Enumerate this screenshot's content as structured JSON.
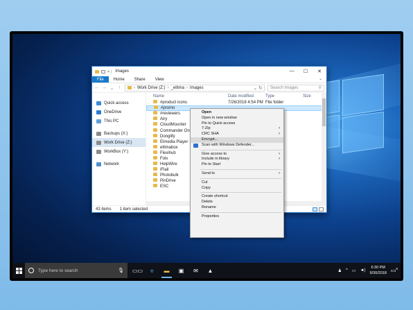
{
  "explorer": {
    "title": "Images",
    "tabs": [
      "File",
      "Home",
      "Share",
      "View"
    ],
    "breadcrumb": [
      "Work Drive (Z:)",
      "_eltima",
      "Images"
    ],
    "search_placeholder": "Search Images",
    "columns": [
      "Name",
      "Date modified",
      "Type",
      "Size"
    ],
    "nav_items": [
      {
        "label": "Quick access",
        "icon": "star-icon",
        "color": "#3b8ad9"
      },
      {
        "label": "OneDrive",
        "icon": "cloud-icon",
        "color": "#2b7cd3"
      },
      {
        "label": "This PC",
        "icon": "computer-icon",
        "color": "#5fa0dd"
      },
      {
        "label": "Backups (X:)",
        "icon": "drive-icon",
        "color": "#8a8a8a"
      },
      {
        "label": "Work Drive (Z:)",
        "icon": "drive-icon",
        "color": "#8a8a8a",
        "selected": true
      },
      {
        "label": "WorkBox (Y:)",
        "icon": "drive-icon",
        "color": "#8a8a8a"
      },
      {
        "label": "Network",
        "icon": "network-icon",
        "color": "#4f8fd0"
      }
    ],
    "files": [
      {
        "name": "#product icons",
        "date": "7/26/2018 4:54 PM",
        "type": "File folder"
      },
      {
        "name": "#promo",
        "date": "",
        "type": "",
        "selected": true
      },
      {
        "name": "#reviewers",
        "date": "",
        "type": ""
      },
      {
        "name": "Airy",
        "date": "",
        "type": ""
      },
      {
        "name": "CloudMounter",
        "date": "",
        "type": ""
      },
      {
        "name": "Commander One",
        "date": "",
        "type": ""
      },
      {
        "name": "Donglify",
        "date": "",
        "type": ""
      },
      {
        "name": "Elmedia Player",
        "date": "",
        "type": ""
      },
      {
        "name": "eltimabox",
        "date": "",
        "type": ""
      },
      {
        "name": "Flexihub",
        "date": "",
        "type": ""
      },
      {
        "name": "Folx",
        "date": "",
        "type": ""
      },
      {
        "name": "HelpWire",
        "date": "",
        "type": ""
      },
      {
        "name": "iFlail",
        "date": "",
        "type": ""
      },
      {
        "name": "Photobulk",
        "date": "",
        "type": ""
      },
      {
        "name": "PinDrive",
        "date": "",
        "type": ""
      },
      {
        "name": "ESC",
        "date": "",
        "type": ""
      }
    ],
    "status_count": "43 items",
    "status_selected": "1 item selected"
  },
  "context_menu": {
    "items": [
      {
        "label": "Open",
        "bold": true
      },
      {
        "label": "Open in new window"
      },
      {
        "label": "Pin to Quick access"
      },
      {
        "label": "7-Zip",
        "submenu": true
      },
      {
        "label": "CRC SHA",
        "submenu": true
      },
      {
        "label": "Encrypt...",
        "highlighted": true
      },
      {
        "label": "Scan with Windows Defender...",
        "shield": true
      },
      {
        "sep": true
      },
      {
        "label": "Give access to",
        "submenu": true
      },
      {
        "label": "Include in library",
        "submenu": true
      },
      {
        "label": "Pin to Start"
      },
      {
        "sep": true
      },
      {
        "label": "Send to",
        "submenu": true
      },
      {
        "sep": true
      },
      {
        "label": "Cut"
      },
      {
        "label": "Copy"
      },
      {
        "sep": true
      },
      {
        "label": "Create shortcut"
      },
      {
        "label": "Delete"
      },
      {
        "label": "Rename"
      },
      {
        "sep": true
      },
      {
        "label": "Properties"
      }
    ]
  },
  "taskbar": {
    "search_placeholder": "Type here to search",
    "apps": [
      {
        "name": "task-view-icon",
        "glyph": "▭▭"
      },
      {
        "name": "edge-icon",
        "glyph": "e",
        "color": "#3c9be8"
      },
      {
        "name": "file-explorer-icon",
        "glyph": "▬",
        "color": "#f2c34b",
        "active": true
      },
      {
        "name": "store-icon",
        "glyph": "▣"
      },
      {
        "name": "mail-icon",
        "glyph": "✉"
      },
      {
        "name": "photos-icon",
        "glyph": "▲"
      }
    ],
    "time": "6:30 PM",
    "date": "9/30/2018",
    "notification_count": "5"
  }
}
